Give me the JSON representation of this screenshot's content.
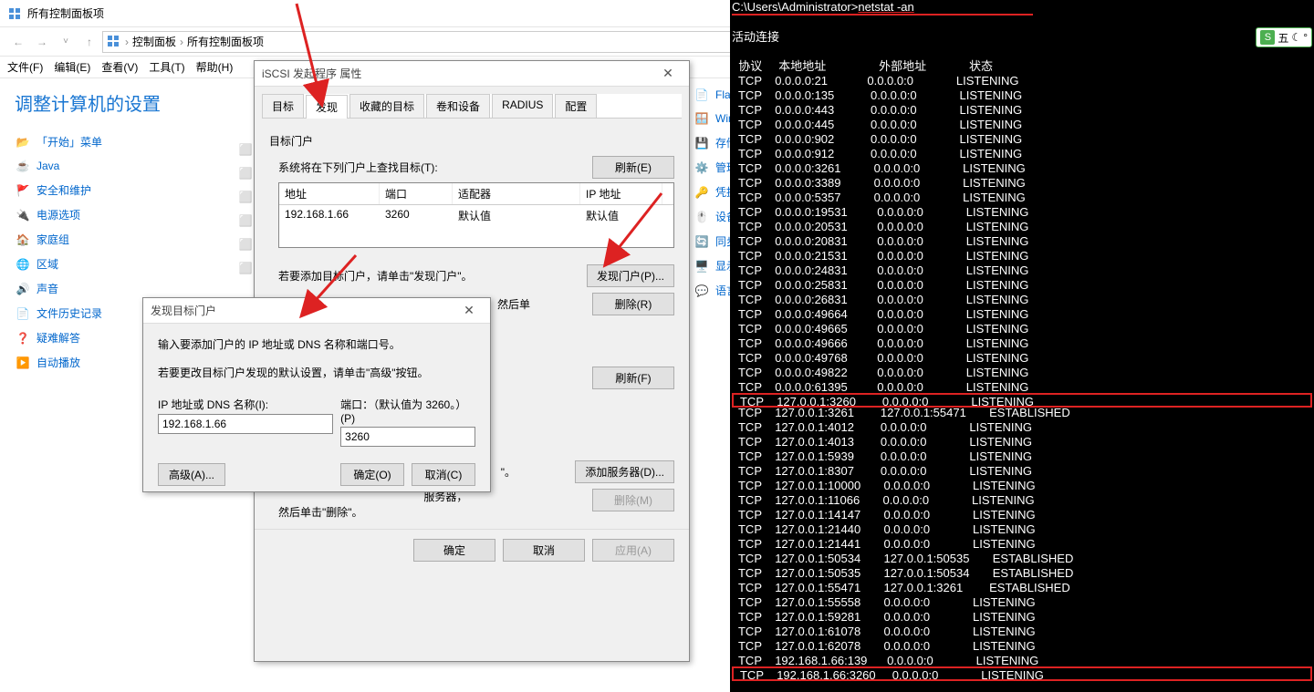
{
  "window": {
    "title": "所有控制面板项",
    "breadcrumb": [
      "控制面板",
      "所有控制面板项"
    ]
  },
  "menus": {
    "file": "文件(F)",
    "edit": "编辑(E)",
    "view": "查看(V)",
    "tools": "工具(T)",
    "help": "帮助(H)"
  },
  "cp": {
    "heading": "调整计算机的设置",
    "left_items": [
      {
        "icon": "📂",
        "label": "「开始」菜单"
      },
      {
        "icon": "☕",
        "label": "Java"
      },
      {
        "icon": "🚩",
        "label": "安全和维护"
      },
      {
        "icon": "🔌",
        "label": "电源选项"
      },
      {
        "icon": "🏠",
        "label": "家庭组"
      },
      {
        "icon": "🌐",
        "label": "区域"
      },
      {
        "icon": "🔊",
        "label": "声音"
      },
      {
        "icon": "📄",
        "label": "文件历史记录"
      },
      {
        "icon": "❓",
        "label": "疑难解答"
      },
      {
        "icon": "▶️",
        "label": "自动播放"
      }
    ],
    "mid_icons": [
      "⬜",
      "⬜",
      "⬜",
      "⬜",
      "⬜",
      "⬜"
    ],
    "right_items": [
      {
        "icon": "📄",
        "label": "Flash"
      },
      {
        "icon": "🪟",
        "label": "Wind"
      },
      {
        "icon": "💾",
        "label": "存储空"
      },
      {
        "icon": "⚙️",
        "label": "管理工"
      },
      {
        "icon": "🔑",
        "label": "凭据管"
      },
      {
        "icon": "🖱️",
        "label": "设备管"
      },
      {
        "icon": "🔄",
        "label": "同步中"
      },
      {
        "icon": "🖥️",
        "label": "显示"
      },
      {
        "icon": "💬",
        "label": "语言"
      }
    ]
  },
  "iscsi": {
    "title": "iSCSI 发起程序 属性",
    "tabs": [
      "目标",
      "发现",
      "收藏的目标",
      "卷和设备",
      "RADIUS",
      "配置"
    ],
    "active_tab": 1,
    "section1": {
      "title": "目标门户",
      "subtitle": "系统将在下列门户上查找目标(T):",
      "refresh": "刷新(E)",
      "cols": {
        "addr": "地址",
        "port": "端口",
        "adapter": "适配器",
        "ip": "IP 地址"
      },
      "row": {
        "addr": "192.168.1.66",
        "port": "3260",
        "adapter": "默认值",
        "ip": "默认值"
      },
      "add_text": "若要添加目标门户，请单击\"发现门户\"。",
      "del_text": "若要删除某个目标门户，请选择上方的地址，然后单",
      "discover_btn": "发现门户(P)...",
      "delete_btn": "删除(R)"
    },
    "section2": {
      "refresh": "刷新(F)",
      "text_tail": "\"。",
      "add_server": "添加服务器(D)...",
      "del_server": "删除(M)",
      "del_text": "然后单击\"删除\"。",
      "tail2": "服务器，"
    },
    "footer": {
      "ok": "确定",
      "cancel": "取消",
      "apply": "应用(A)"
    }
  },
  "discover": {
    "title": "发现目标门户",
    "line1": "输入要添加门户的 IP 地址或 DNS 名称和端口号。",
    "line2": "若要更改目标门户发现的默认设置，请单击\"高级\"按钮。",
    "ip_label": "IP 地址或 DNS 名称(I):",
    "port_label": "端口：（默认值为 3260。）(P)",
    "ip_value": "192.168.1.66",
    "port_value": "3260",
    "advanced": "高级(A)...",
    "ok": "确定(O)",
    "cancel": "取消(C)"
  },
  "terminal": {
    "prompt": "C:\\Users\\Administrator>",
    "cmd": "netstat -an",
    "header": "活动连接",
    "cols": {
      "proto": "协议",
      "local": "本地地址",
      "foreign": "外部地址",
      "state": "状态"
    },
    "rows": [
      [
        "TCP",
        "0.0.0.0:21",
        "0.0.0.0:0",
        "LISTENING"
      ],
      [
        "TCP",
        "0.0.0.0:135",
        "0.0.0.0:0",
        "LISTENING"
      ],
      [
        "TCP",
        "0.0.0.0:443",
        "0.0.0.0:0",
        "LISTENING"
      ],
      [
        "TCP",
        "0.0.0.0:445",
        "0.0.0.0:0",
        "LISTENING"
      ],
      [
        "TCP",
        "0.0.0.0:902",
        "0.0.0.0:0",
        "LISTENING"
      ],
      [
        "TCP",
        "0.0.0.0:912",
        "0.0.0.0:0",
        "LISTENING"
      ],
      [
        "TCP",
        "0.0.0.0:3261",
        "0.0.0.0:0",
        "LISTENING"
      ],
      [
        "TCP",
        "0.0.0.0:3389",
        "0.0.0.0:0",
        "LISTENING"
      ],
      [
        "TCP",
        "0.0.0.0:5357",
        "0.0.0.0:0",
        "LISTENING"
      ],
      [
        "TCP",
        "0.0.0.0:19531",
        "0.0.0.0:0",
        "LISTENING"
      ],
      [
        "TCP",
        "0.0.0.0:20531",
        "0.0.0.0:0",
        "LISTENING"
      ],
      [
        "TCP",
        "0.0.0.0:20831",
        "0.0.0.0:0",
        "LISTENING"
      ],
      [
        "TCP",
        "0.0.0.0:21531",
        "0.0.0.0:0",
        "LISTENING"
      ],
      [
        "TCP",
        "0.0.0.0:24831",
        "0.0.0.0:0",
        "LISTENING"
      ],
      [
        "TCP",
        "0.0.0.0:25831",
        "0.0.0.0:0",
        "LISTENING"
      ],
      [
        "TCP",
        "0.0.0.0:26831",
        "0.0.0.0:0",
        "LISTENING"
      ],
      [
        "TCP",
        "0.0.0.0:49664",
        "0.0.0.0:0",
        "LISTENING"
      ],
      [
        "TCP",
        "0.0.0.0:49665",
        "0.0.0.0:0",
        "LISTENING"
      ],
      [
        "TCP",
        "0.0.0.0:49666",
        "0.0.0.0:0",
        "LISTENING"
      ],
      [
        "TCP",
        "0.0.0.0:49768",
        "0.0.0.0:0",
        "LISTENING"
      ],
      [
        "TCP",
        "0.0.0.0:49822",
        "0.0.0.0:0",
        "LISTENING"
      ],
      [
        "TCP",
        "0.0.0.0:61395",
        "0.0.0.0:0",
        "LISTENING"
      ],
      [
        "TCP",
        "127.0.0.1:3260",
        "0.0.0.0:0",
        "LISTENING"
      ],
      [
        "TCP",
        "127.0.0.1:3261",
        "127.0.0.1:55471",
        "ESTABLISHED"
      ],
      [
        "TCP",
        "127.0.0.1:4012",
        "0.0.0.0:0",
        "LISTENING"
      ],
      [
        "TCP",
        "127.0.0.1:4013",
        "0.0.0.0:0",
        "LISTENING"
      ],
      [
        "TCP",
        "127.0.0.1:5939",
        "0.0.0.0:0",
        "LISTENING"
      ],
      [
        "TCP",
        "127.0.0.1:8307",
        "0.0.0.0:0",
        "LISTENING"
      ],
      [
        "TCP",
        "127.0.0.1:10000",
        "0.0.0.0:0",
        "LISTENING"
      ],
      [
        "TCP",
        "127.0.0.1:11066",
        "0.0.0.0:0",
        "LISTENING"
      ],
      [
        "TCP",
        "127.0.0.1:14147",
        "0.0.0.0:0",
        "LISTENING"
      ],
      [
        "TCP",
        "127.0.0.1:21440",
        "0.0.0.0:0",
        "LISTENING"
      ],
      [
        "TCP",
        "127.0.0.1:21441",
        "0.0.0.0:0",
        "LISTENING"
      ],
      [
        "TCP",
        "127.0.0.1:50534",
        "127.0.0.1:50535",
        "ESTABLISHED"
      ],
      [
        "TCP",
        "127.0.0.1:50535",
        "127.0.0.1:50534",
        "ESTABLISHED"
      ],
      [
        "TCP",
        "127.0.0.1:55471",
        "127.0.0.1:3261",
        "ESTABLISHED"
      ],
      [
        "TCP",
        "127.0.0.1:55558",
        "0.0.0.0:0",
        "LISTENING"
      ],
      [
        "TCP",
        "127.0.0.1:59281",
        "0.0.0.0:0",
        "LISTENING"
      ],
      [
        "TCP",
        "127.0.0.1:61078",
        "0.0.0.0:0",
        "LISTENING"
      ],
      [
        "TCP",
        "127.0.0.1:62078",
        "0.0.0.0:0",
        "LISTENING"
      ],
      [
        "TCP",
        "192.168.1.66:139",
        "0.0.0.0:0",
        "LISTENING"
      ],
      [
        "TCP",
        "192.168.1.66:3260",
        "0.0.0.0:0",
        "LISTENING"
      ]
    ],
    "highlight_indices": [
      22,
      41
    ]
  },
  "ime": {
    "label": "五",
    "moon": "☾",
    "dot": "°"
  }
}
